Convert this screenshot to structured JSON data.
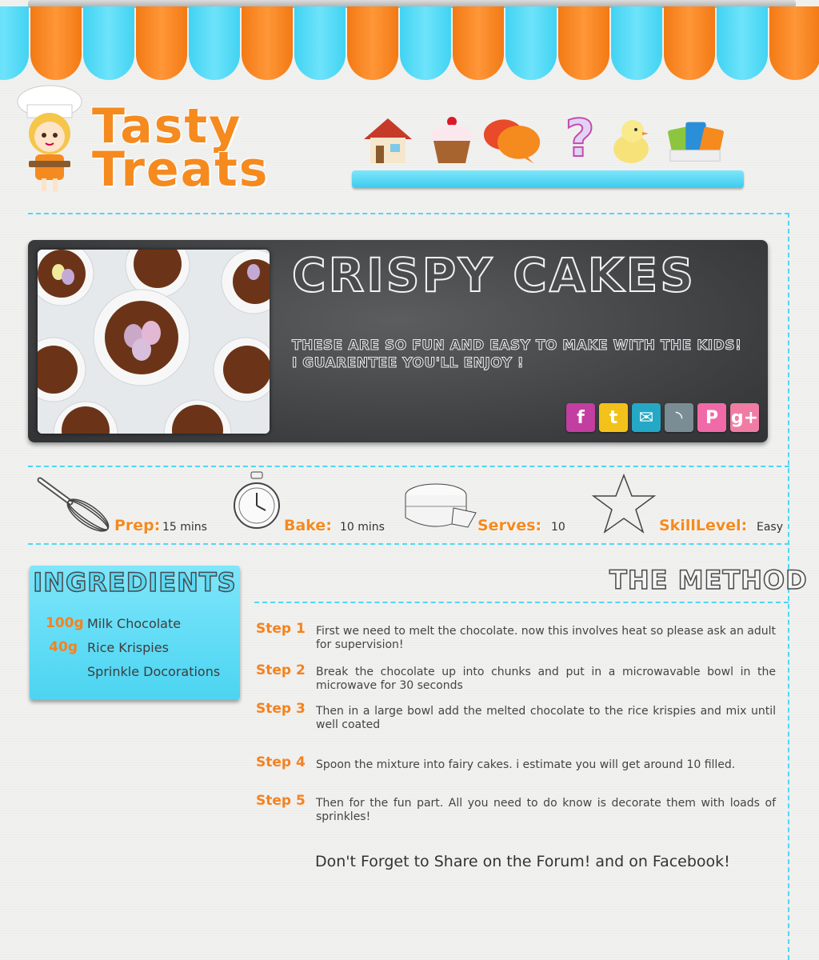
{
  "logo": {
    "line1": "Tasty",
    "line2": "Treats"
  },
  "nav": {
    "icons": [
      "house-icon",
      "cupcake-icon",
      "chat-bubbles-icon",
      "question-mark-icon",
      "chick-icon",
      "coupons-icon"
    ]
  },
  "recipe": {
    "title": "CRISPY CAKES",
    "line1": "THESE ARE SO FUN AND EASY TO MAKE WITH THE KIDS!",
    "line2": "I GUARENTEE YOU'LL ENJOY !",
    "social": [
      {
        "name": "facebook",
        "label": "f",
        "color": "#c23ea0"
      },
      {
        "name": "twitter",
        "label": "t",
        "color": "#f2c21a"
      },
      {
        "name": "email",
        "label": "✉",
        "color": "#24a8c6"
      },
      {
        "name": "rss",
        "label": "◝",
        "color": "#7b8d94"
      },
      {
        "name": "pinterest",
        "label": "P",
        "color": "#f06aa8"
      },
      {
        "name": "google-plus",
        "label": "g+",
        "color": "#f07ca4"
      }
    ]
  },
  "stats": {
    "prep_label": "Prep:",
    "prep_value": "15 mins",
    "bake_label": "Bake:",
    "bake_value": "10 mins",
    "serves_label": "Serves:",
    "serves_value": "10",
    "skill_label": "SkillLevel:",
    "skill_value": "Easy"
  },
  "ingredients": {
    "title": "INGREDIENTS",
    "items": [
      {
        "qty": "100g",
        "name": "Milk Chocolate"
      },
      {
        "qty": "40g",
        "name": "Rice Krispies"
      },
      {
        "qty": "",
        "name": "Sprinkle Docorations"
      }
    ]
  },
  "method": {
    "title": "THE METHOD",
    "steps": [
      {
        "label": "Step 1",
        "text": "First we need to melt the chocolate. now this involves heat so please ask an adult for supervision!"
      },
      {
        "label": "Step 2",
        "text": "Break the chocolate up into chunks and put in a microwavable bowl in the microwave for 30 seconds"
      },
      {
        "label": "Step 3",
        "text": "Then in a large bowl add the melted chocolate to the rice krispies and mix until well coated"
      },
      {
        "label": "Step 4",
        "text": "Spoon the mixture into fairy cakes. i estimate you will get around 10 filled."
      },
      {
        "label": "Step 5",
        "text": "Then for the fun part. All you need to do know is decorate them with loads of sprinkles!"
      }
    ],
    "footer": "Don't Forget to Share on the Forum! and on Facebook!"
  }
}
